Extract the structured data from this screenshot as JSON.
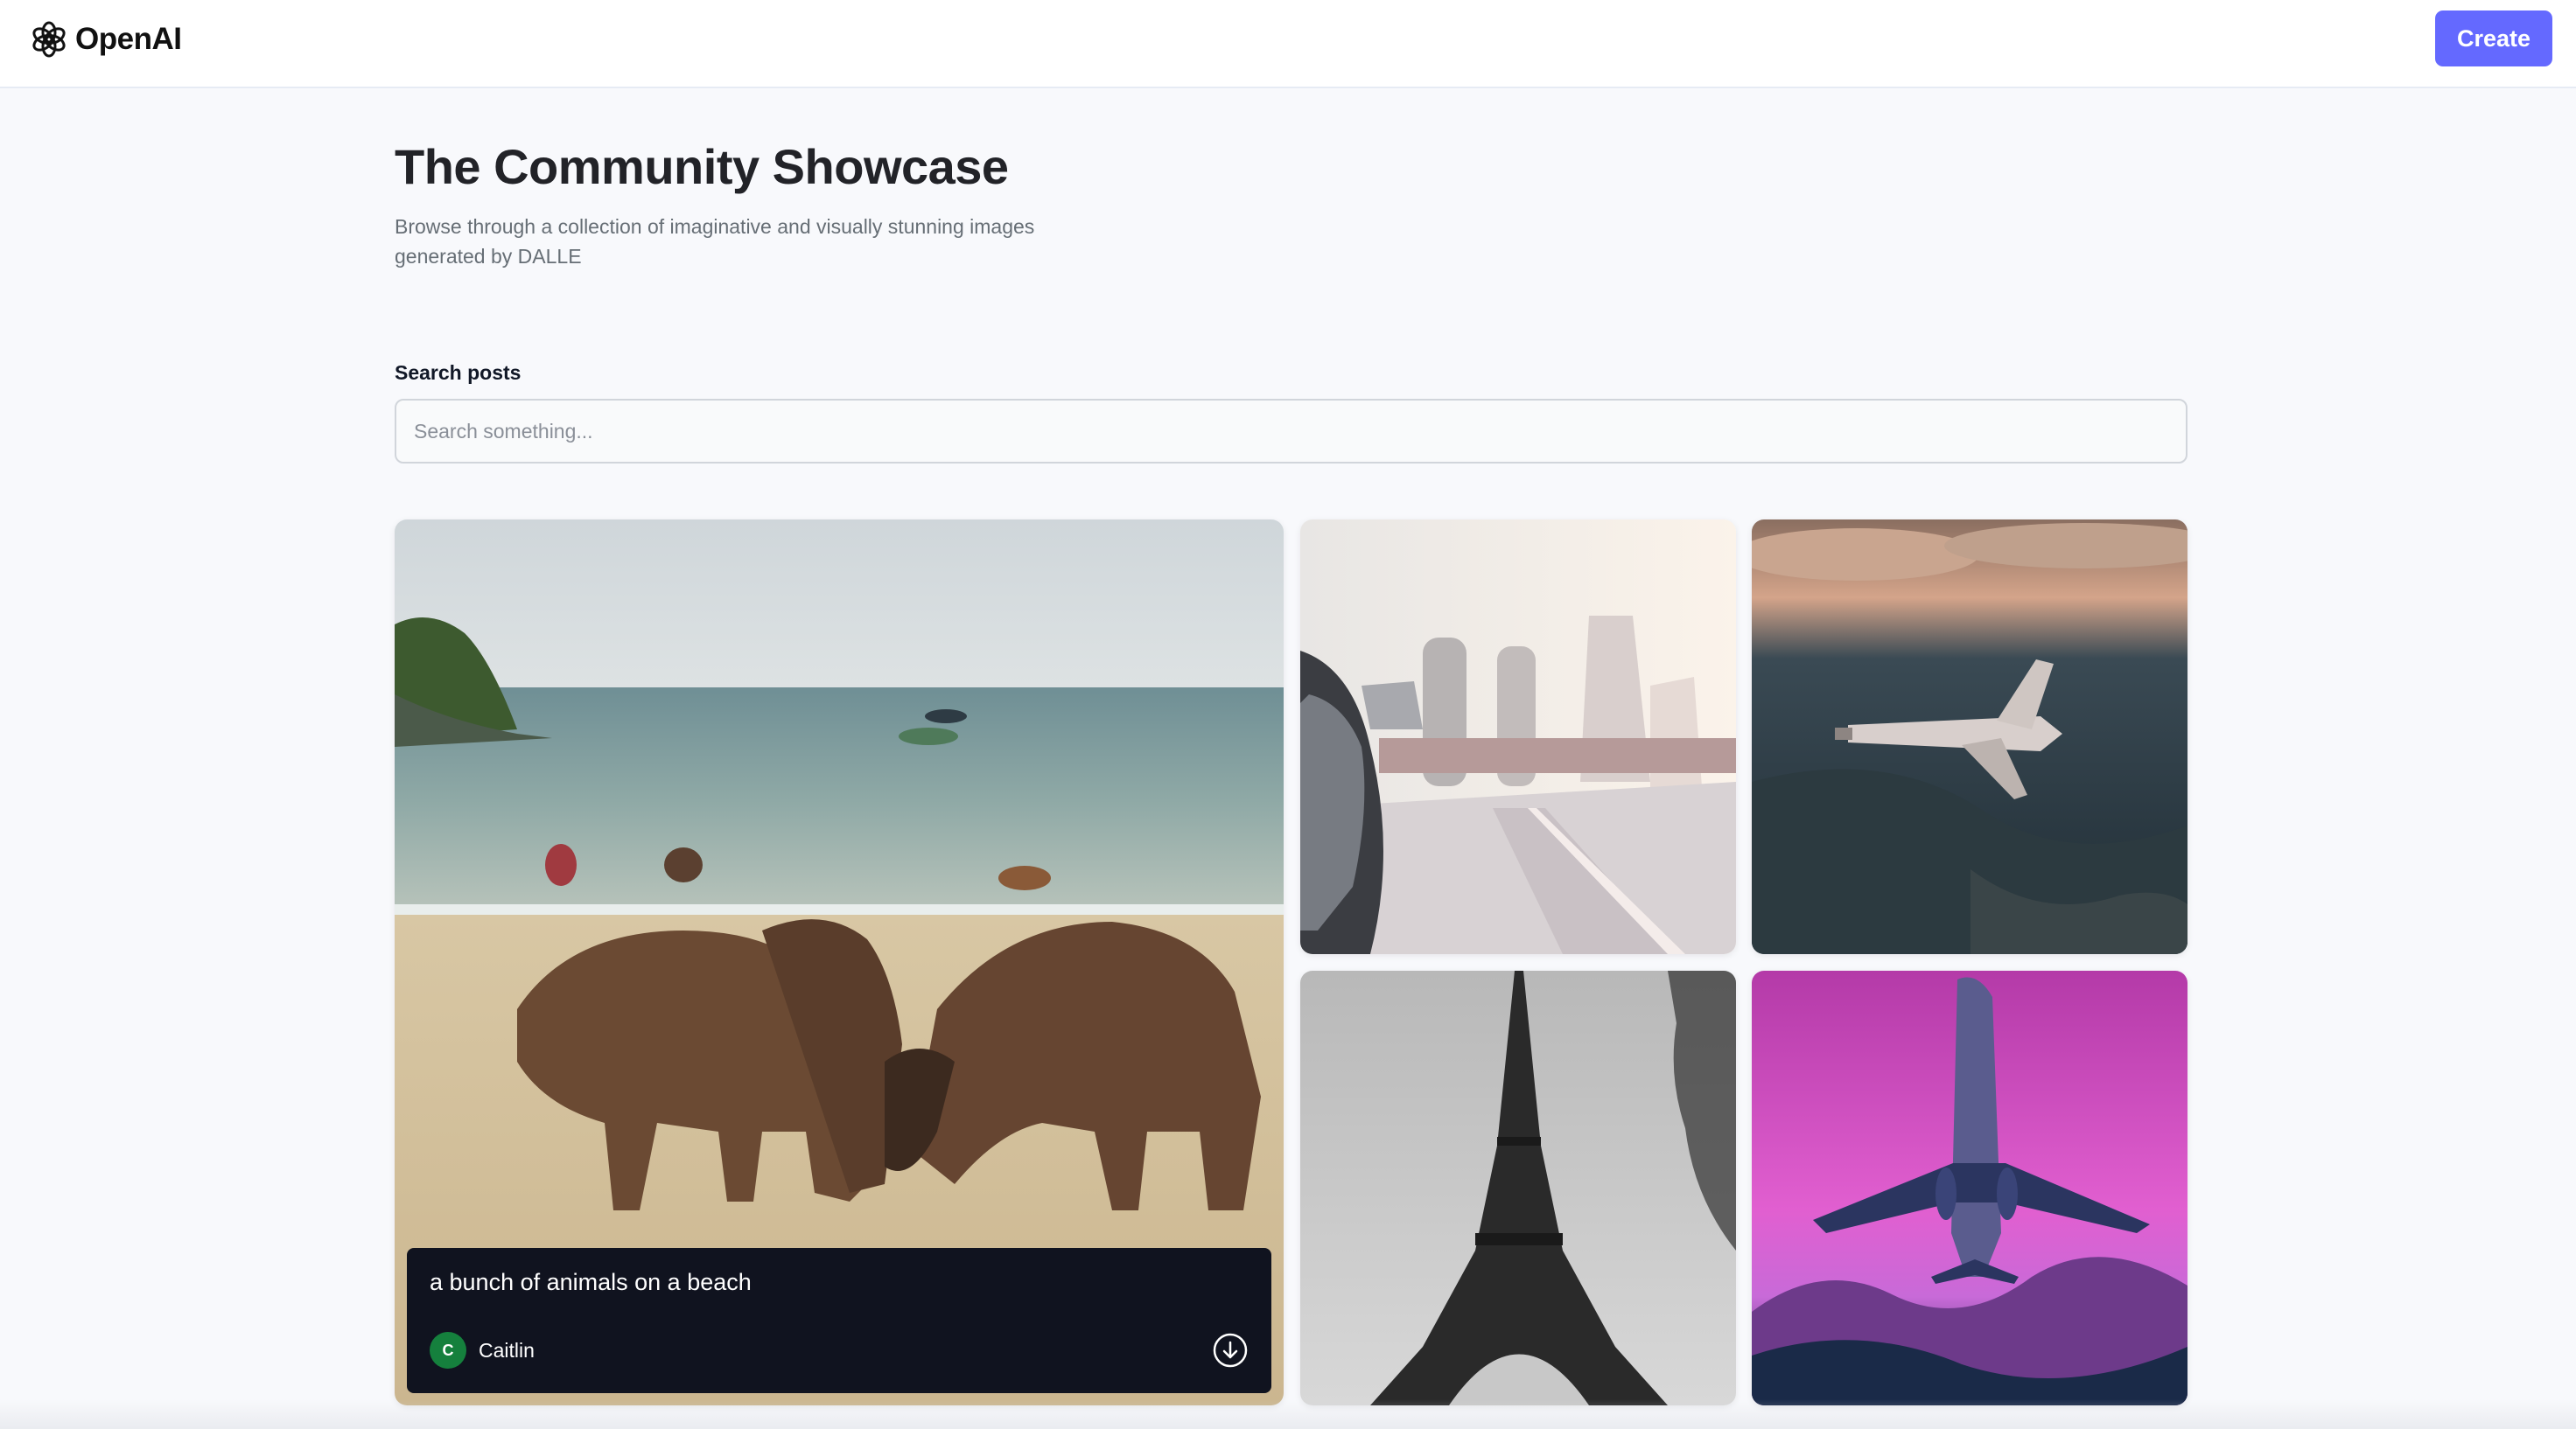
{
  "header": {
    "logo_text": "OpenAI",
    "logo_icon": "openai-logo-icon",
    "create_label": "Create",
    "accent_color": "#6469ff"
  },
  "intro": {
    "title": "The Community Showcase",
    "subtitle": "Browse through a collection of imaginative and visually stunning images generated by DALLE"
  },
  "search": {
    "label": "Search posts",
    "placeholder": "Search something...",
    "value": ""
  },
  "posts": [
    {
      "prompt": "a bunch of animals on a beach",
      "author": "Caitlin",
      "author_initial": "C",
      "download_icon": "download-icon"
    },
    {
      "prompt": "",
      "author": ""
    },
    {
      "prompt": "",
      "author": ""
    },
    {
      "prompt": "",
      "author": ""
    },
    {
      "prompt": "",
      "author": ""
    }
  ]
}
